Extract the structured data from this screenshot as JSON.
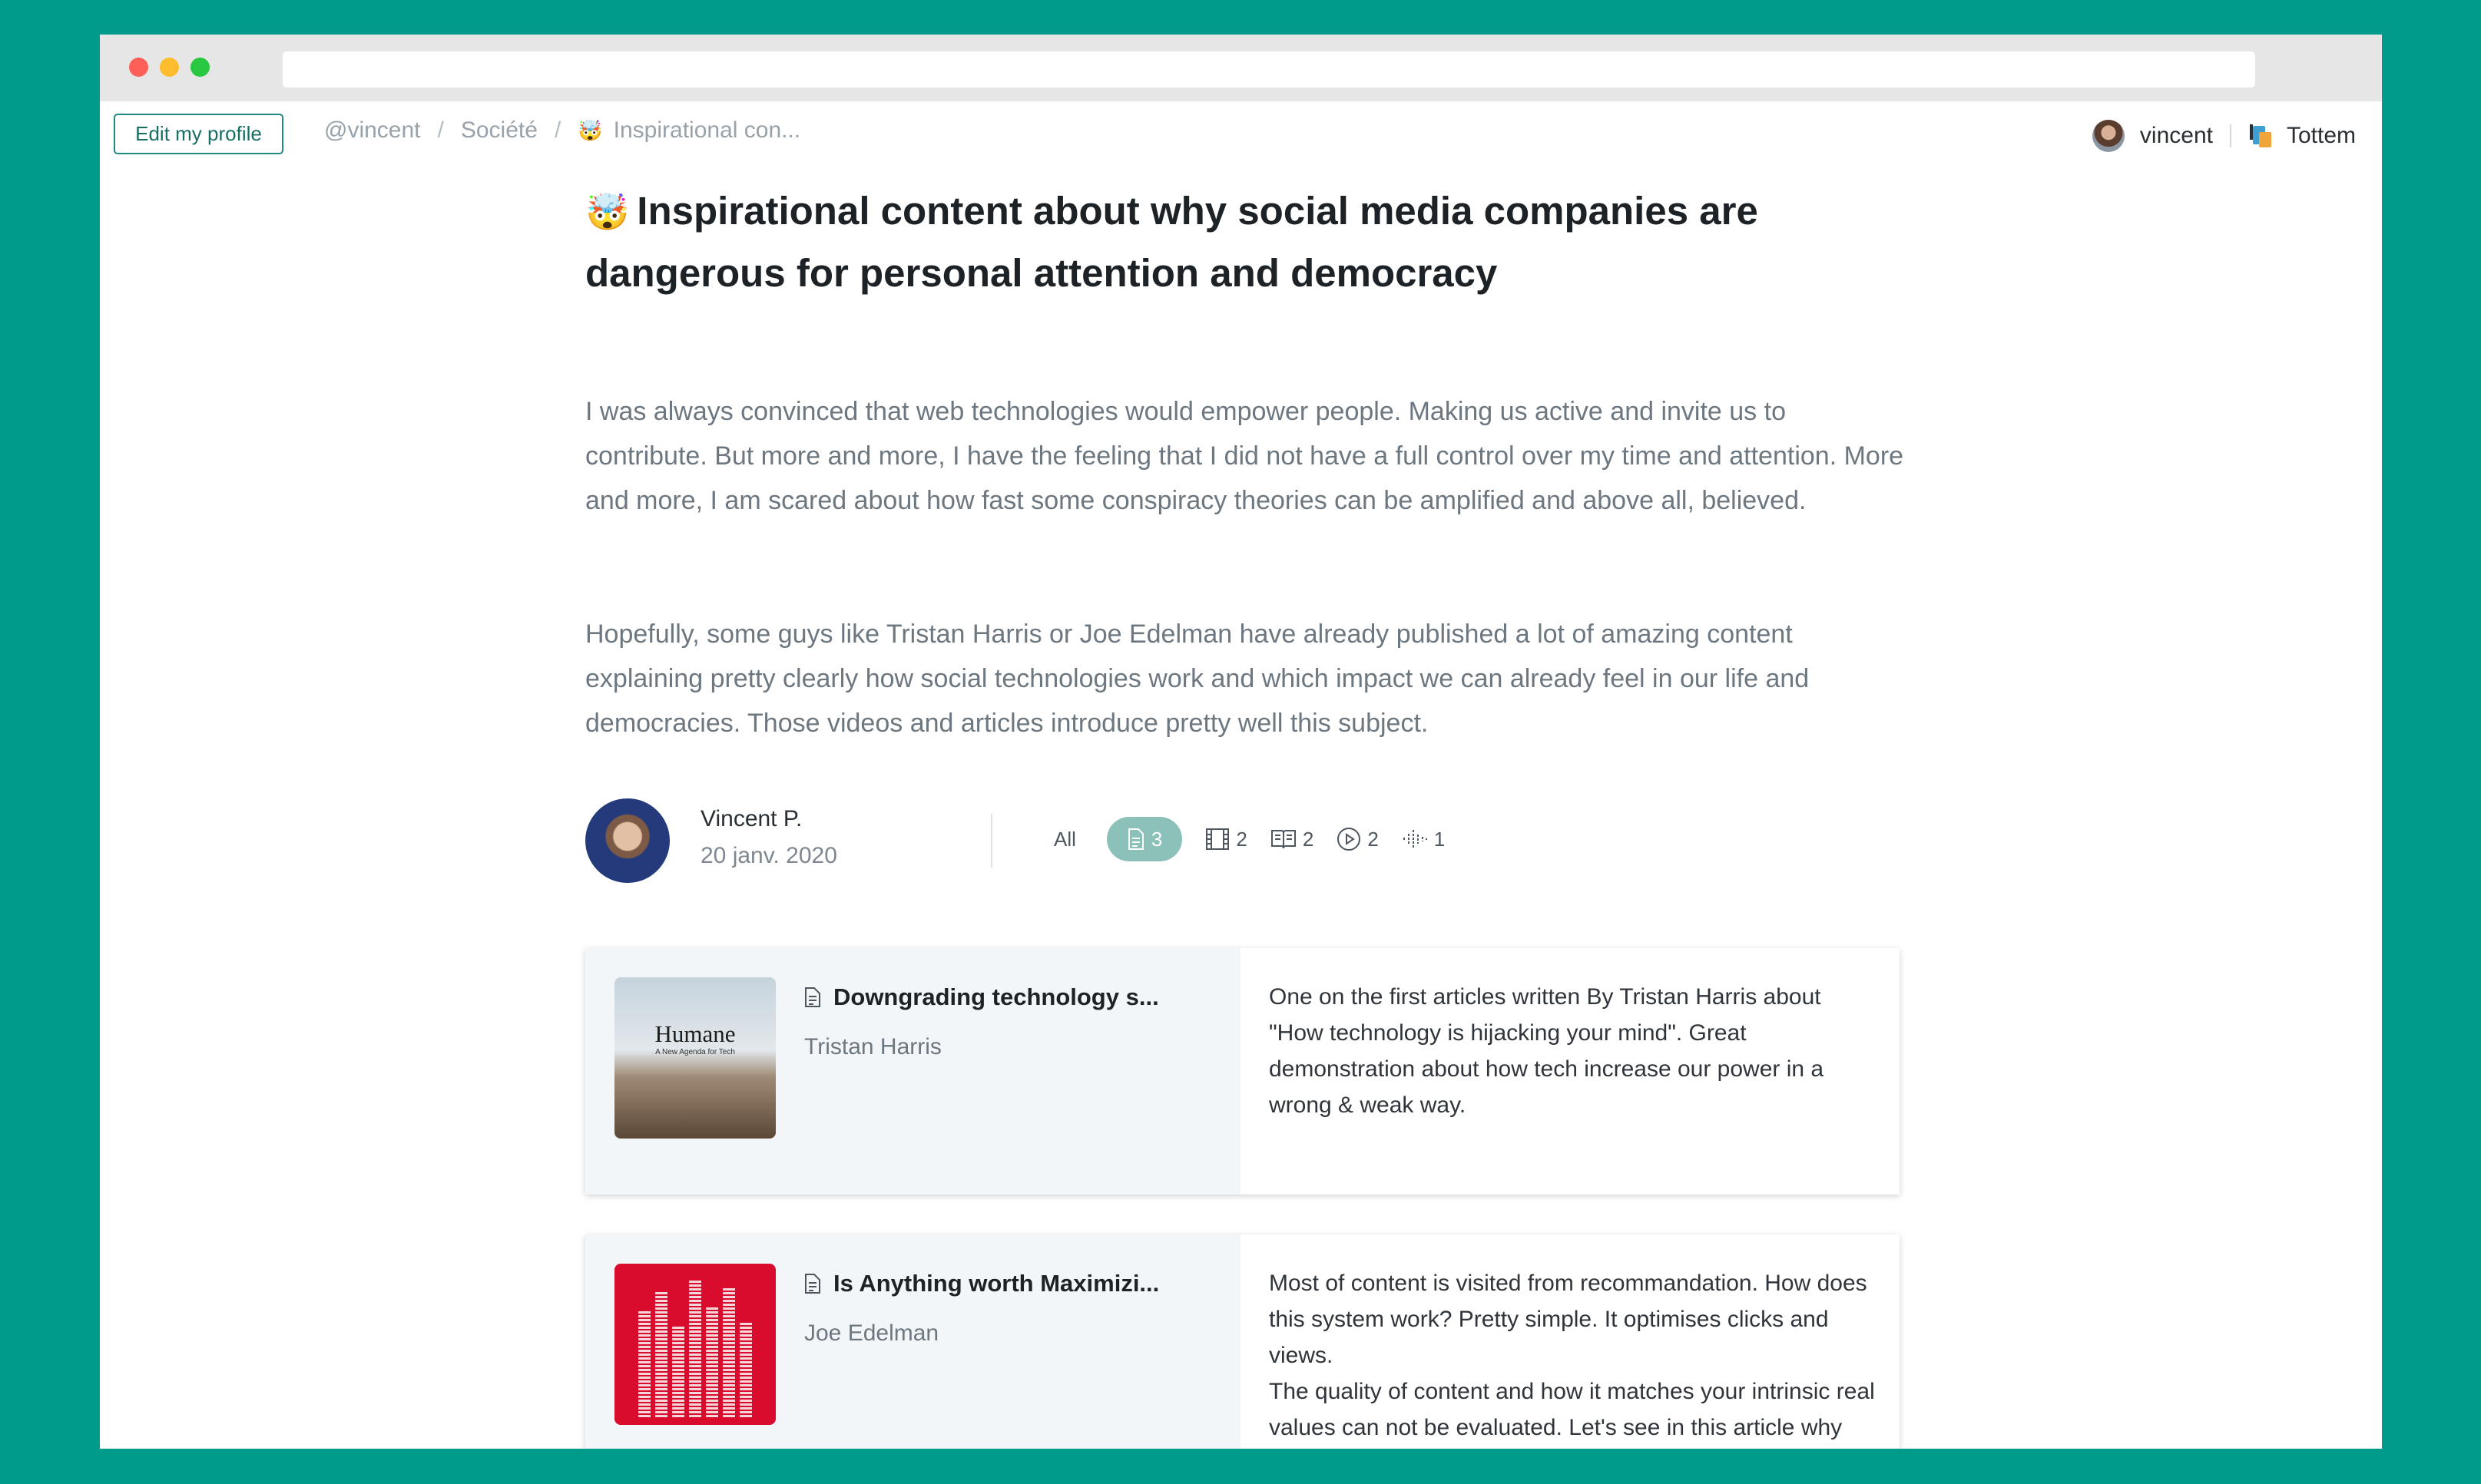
{
  "nav": {
    "edit_profile_label": "Edit my profile",
    "breadcrumb": [
      "@vincent",
      "Société",
      "Inspirational con..."
    ],
    "breadcrumb_emoji": "🤯",
    "separator": "/",
    "username": "vincent",
    "brand": "Tottem"
  },
  "collection": {
    "emoji": "🤯",
    "title": "Inspirational content about why social media companies are dangerous for personal attention and democracy",
    "paragraphs": [
      "I was always convinced that web technologies would empower people. Making us active and invite us to contribute. But more and more, I have the feeling that I did not have a full control over my time and attention. More and more, I am scared about how fast some conspiracy theories can be amplified and above all, believed.",
      "Hopefully, some guys like Tristan Harris or Joe Edelman have already published a lot of amazing content explaining pretty clearly how social technologies work and which impact we can already feel in our life and democracies. Those videos and articles introduce pretty well this subject."
    ]
  },
  "author": {
    "name": "Vincent P.",
    "date": "20 janv. 2020"
  },
  "filters": [
    {
      "label": "All",
      "icon": "all"
    },
    {
      "icon": "article-icon",
      "count": "3",
      "active": true
    },
    {
      "icon": "film-icon",
      "count": "2"
    },
    {
      "icon": "book-icon",
      "count": "2"
    },
    {
      "icon": "play-icon",
      "count": "2"
    },
    {
      "icon": "podcast-icon",
      "count": "1"
    }
  ],
  "items": [
    {
      "thumb_brand": "Humane",
      "thumb_sub": "A New Agenda for Tech",
      "title": "Downgrading technology s...",
      "author": "Tristan Harris",
      "comment": "One on the first articles written By Tristan Harris about \"How technology is hijacking your mind\". Great demonstration about how tech increase our power in a wrong & weak way."
    },
    {
      "title": "Is Anything worth Maximizi...",
      "author": "Joe Edelman",
      "comment_lines": [
        "Most of content is visited from recommandation. How does this system work? Pretty simple. It optimises clicks and views.",
        "The quality of content and how it matches your intrinsic real values can not be evaluated. Let's see in this article why it's so broken and how we could do"
      ]
    }
  ],
  "colors": {
    "background": "#009b8a",
    "accent": "#1f8a7e",
    "active_filter": "#8bc1b8"
  }
}
